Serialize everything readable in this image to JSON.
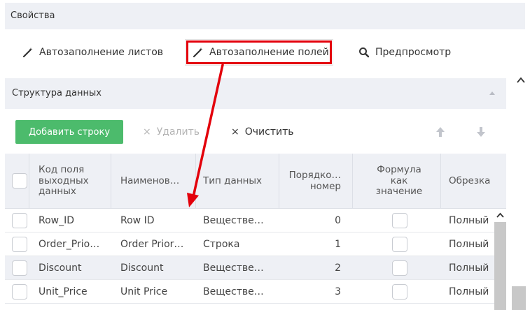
{
  "properties": {
    "title": "Свойства"
  },
  "toolbar": {
    "autofill_sheets": "Автозаполнение листов",
    "autofill_fields": "Автозаполнение полей",
    "preview": "Предпросмотр"
  },
  "section": {
    "title": "Структура данных"
  },
  "actions": {
    "add_row": "Добавить строку",
    "delete": "Удалить",
    "clear": "Очистить"
  },
  "grid": {
    "columns": [
      {
        "label": "Код поля\nвыходных\nданных"
      },
      {
        "label": "Наименов…"
      },
      {
        "label": "Тип данных"
      },
      {
        "label": "Порядко…\nномер"
      },
      {
        "label": "Формула\nкак\nзначение"
      },
      {
        "label": "Обрезка"
      }
    ],
    "rows": [
      {
        "code": "Row_ID",
        "name": "Row ID",
        "type": "Веществе…",
        "order": "0",
        "trim": "Полный"
      },
      {
        "code": "Order_Prio…",
        "name": "Order Prior…",
        "type": "Строка",
        "order": "1",
        "trim": "Полный"
      },
      {
        "code": "Discount",
        "name": "Discount",
        "type": "Веществе…",
        "order": "2",
        "trim": "Полный"
      },
      {
        "code": "Unit_Price",
        "name": "Unit Price",
        "type": "Веществе…",
        "order": "3",
        "trim": "Полный"
      }
    ]
  },
  "colors": {
    "accent_green": "#4cbb6c",
    "highlight_red": "#e3000b",
    "header_bg": "#eef0f5"
  }
}
